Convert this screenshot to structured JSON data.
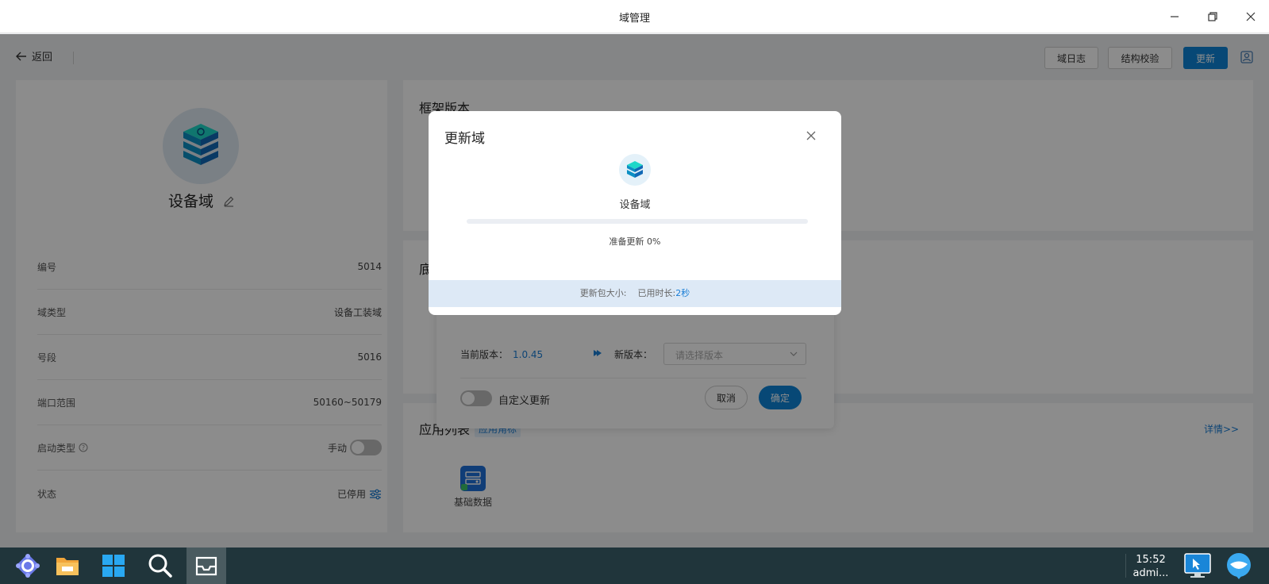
{
  "window": {
    "title": "域管理"
  },
  "toolbar": {
    "back_label": "返回",
    "log_label": "域日志",
    "verify_label": "结构校验",
    "update_label": "更新"
  },
  "domain": {
    "name": "设备域",
    "info": [
      {
        "key": "number",
        "label": "编号",
        "value": "5014"
      },
      {
        "key": "type",
        "label": "域类型",
        "value": "设备工装域"
      },
      {
        "key": "segment",
        "label": "号段",
        "value": "5016"
      },
      {
        "key": "port_range",
        "label": "端口范围",
        "value": "50160~50179"
      },
      {
        "key": "start_type",
        "label": "启动类型",
        "value": "手动"
      },
      {
        "key": "status",
        "label": "状态",
        "value": "已停用"
      }
    ]
  },
  "framework": {
    "title": "框架版本"
  },
  "base": {
    "title_initial": "底"
  },
  "update_card": {
    "current_label": "当前版本：",
    "current_version": "1.0.45",
    "new_label": "新版本：",
    "new_placeholder": "请选择版本",
    "custom_update_label": "自定义更新",
    "cancel_label": "取消",
    "confirm_label": "确定"
  },
  "apps": {
    "title": "应用列表",
    "tag": "应用角标",
    "detail_link": "详情>>",
    "items": [
      {
        "name": "基础数据"
      }
    ]
  },
  "modal": {
    "title": "更新域",
    "domain_name": "设备域",
    "progress_text": "准备更新 0%",
    "progress_value": 0,
    "size_label": "更新包大小:",
    "elapsed_label": "已用时长:",
    "elapsed_value": "2秒"
  },
  "taskbar": {
    "time": "15:52",
    "user": "admi..."
  },
  "colors": {
    "accent": "#0d84d8",
    "taskbar": "#20353b"
  }
}
